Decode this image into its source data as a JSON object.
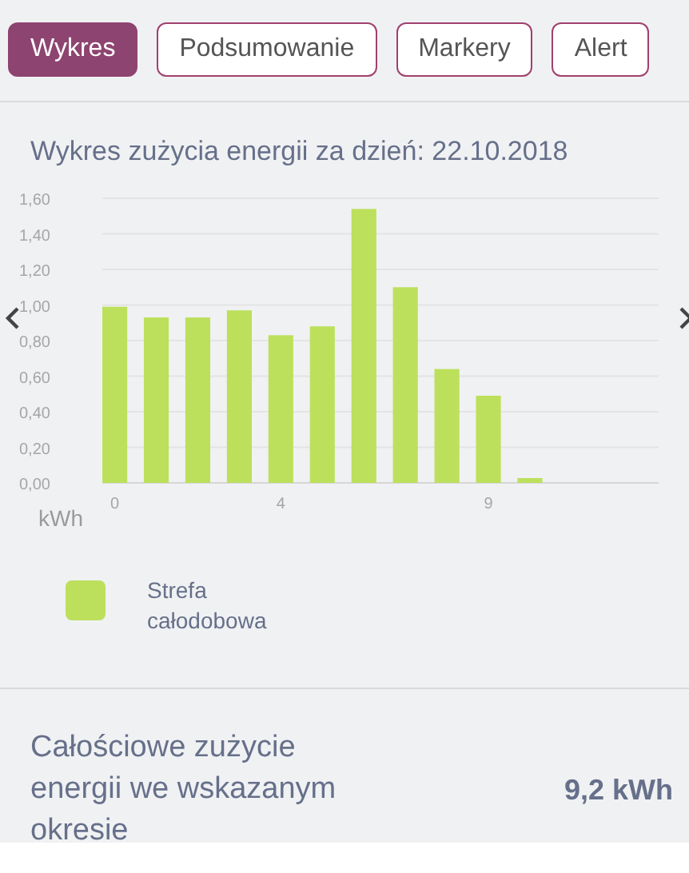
{
  "tabs": [
    {
      "label": "Wykres",
      "selected": true
    },
    {
      "label": "Podsumowanie",
      "selected": false
    },
    {
      "label": "Markery",
      "selected": false
    },
    {
      "label": "Alert",
      "selected": false
    }
  ],
  "chart": {
    "title": "Wykres zużycia energii za dzień: 22.10.2018",
    "chart_data": {
      "type": "bar",
      "ylabel": "kWh",
      "x": [
        0,
        1,
        2,
        3,
        4,
        5,
        6,
        7,
        8,
        9,
        10,
        11,
        12
      ],
      "xlim": [
        -0.3,
        13.1
      ],
      "xticks": [
        0,
        4,
        9
      ],
      "grid": true,
      "ylim": [
        0,
        1.6
      ],
      "yticks": [
        {
          "value": 0,
          "label": "0,00"
        },
        {
          "value": 0.2,
          "label": "0,20"
        },
        {
          "value": 0.4,
          "label": "0,40"
        },
        {
          "value": 0.6,
          "label": "0,60"
        },
        {
          "value": 0.8,
          "label": "0,80"
        },
        {
          "value": 1.0,
          "label": "1,00"
        },
        {
          "value": 1.2,
          "label": "1,20"
        },
        {
          "value": 1.4,
          "label": "1,40"
        },
        {
          "value": 1.6,
          "label": "1,60"
        }
      ],
      "series": [
        {
          "name": "Strefa całodobowa",
          "color": "#bce05c",
          "values": [
            0.99,
            0.93,
            0.93,
            0.97,
            0.83,
            0.88,
            1.54,
            1.1,
            0.64,
            0.49,
            0.02,
            0,
            0
          ]
        }
      ]
    }
  },
  "summary": {
    "label": "Całościowe zużycie energii we wskazanym okresie",
    "value": "9,2 kWh"
  }
}
